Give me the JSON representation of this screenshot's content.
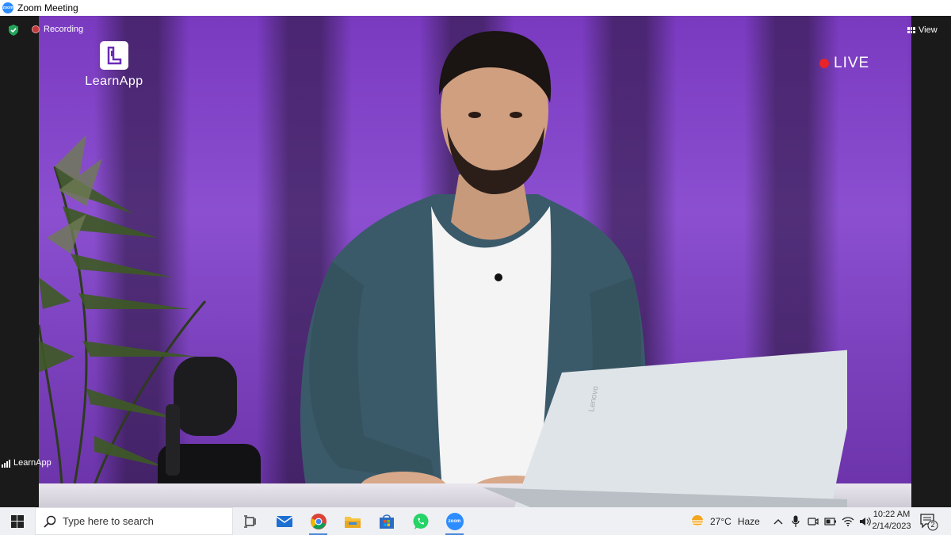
{
  "window": {
    "title": "Zoom Meeting",
    "logo_text": "zoom"
  },
  "meeting": {
    "recording_label": "Recording",
    "view_label": "View",
    "participant_name": "LearnApp"
  },
  "video_overlay": {
    "brand_letter": "L",
    "brand_name": "LearnApp",
    "live_label": "LIVE",
    "laptop_brand": "Lenovo"
  },
  "taskbar": {
    "search_placeholder": "Type here to search",
    "zoom_icon_text": "zoom",
    "pinned": [
      "task-view-icon",
      "mail-icon",
      "chrome-icon",
      "file-explorer-icon",
      "microsoft-store-icon",
      "whatsapp-icon",
      "zoom-icon"
    ],
    "weather": {
      "temp": "27°C",
      "condition": "Haze"
    },
    "time": "10:22 AM",
    "date": "2/14/2023",
    "notifications": "2"
  },
  "colors": {
    "live": "#e8232a",
    "zoom_blue": "#2d8cff",
    "security_green": "#23a55a",
    "backdrop_purple": "#8b4fd0"
  }
}
